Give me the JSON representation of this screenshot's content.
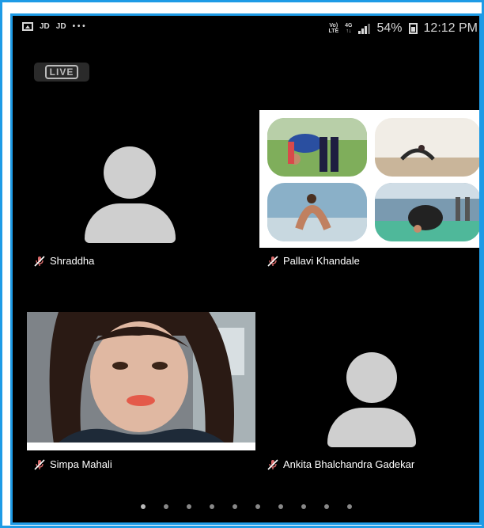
{
  "status_bar": {
    "carrier_1": "JD",
    "carrier_2": "JD",
    "more": "• • •",
    "volte_top": "Vo)",
    "volte_bottom": "LTE",
    "net_top": "4G",
    "net_bottom": "↑↓",
    "battery": "54%",
    "time": "12:12 PM"
  },
  "live_badge": "LIVE",
  "participants": [
    {
      "name": "Shraddha",
      "video": false
    },
    {
      "name": "Pallavi Khandale",
      "video": true
    },
    {
      "name": "Simpa Mahali",
      "video": true
    },
    {
      "name": "Ankita Bhalchandra Gadekar",
      "video": false
    }
  ],
  "pagination": {
    "pages": 10,
    "current": 1
  },
  "colors": {
    "frame": "#1e9be6",
    "background": "#000000",
    "avatar": "#cfcfcf"
  }
}
